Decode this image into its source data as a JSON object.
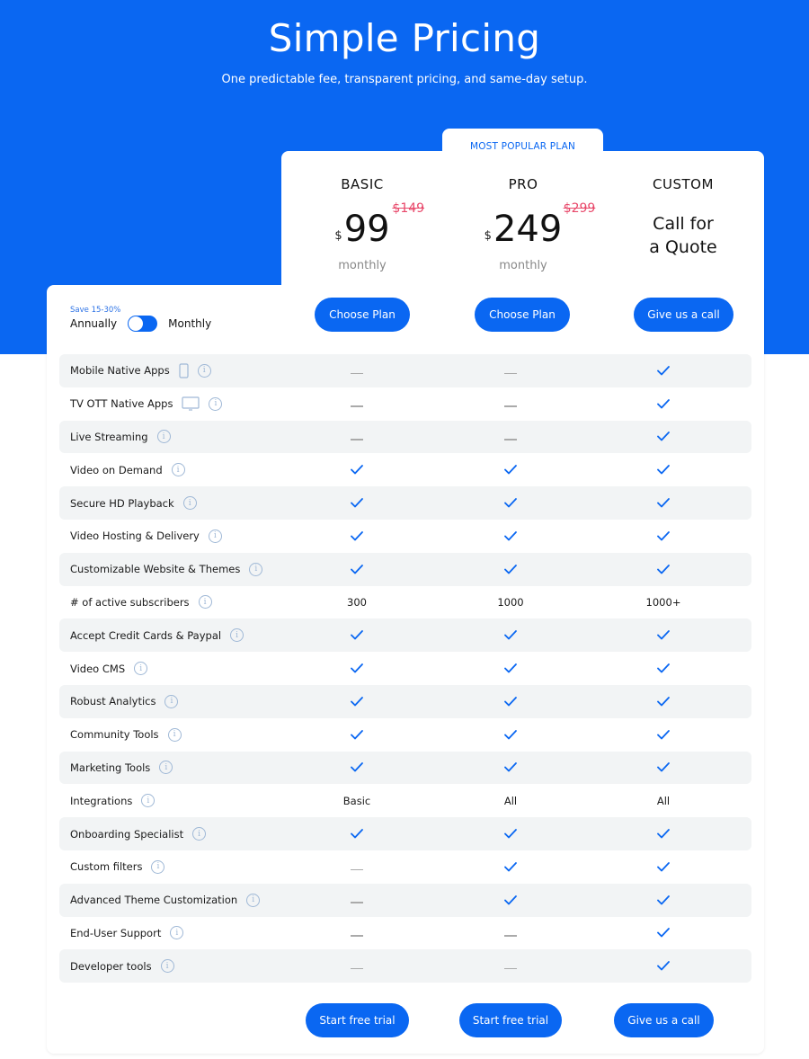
{
  "header": {
    "title": "Simple Pricing",
    "subtitle": "One predictable fee, transparent pricing, and same-day setup."
  },
  "popular_label": "MOST POPULAR PLAN",
  "billing": {
    "save_note": "Save 15-30%",
    "annually_label": "Annually",
    "monthly_label": "Monthly",
    "selected": "Monthly"
  },
  "plans": [
    {
      "name": "BASIC",
      "currency": "$",
      "price": "99",
      "old_price": "$149",
      "period": "monthly",
      "cta": "Choose Plan",
      "bottom_cta": "Start free trial"
    },
    {
      "name": "PRO",
      "currency": "$",
      "price": "249",
      "old_price": "$299",
      "period": "monthly",
      "cta": "Choose Plan",
      "bottom_cta": "Start free trial"
    },
    {
      "name": "CUSTOM",
      "quote": "Call for a Quote",
      "cta": "Give us a call",
      "bottom_cta": "Give us a call"
    }
  ],
  "features": [
    {
      "label": "Mobile Native Apps",
      "icon": "mobile-icon",
      "values": [
        "dash",
        "dash",
        "check"
      ]
    },
    {
      "label": "TV OTT Native Apps",
      "icon": "tv-icon",
      "values": [
        "dash",
        "dash",
        "check"
      ]
    },
    {
      "label": "Live Streaming",
      "values": [
        "dash",
        "dash",
        "check"
      ]
    },
    {
      "label": "Video on Demand",
      "values": [
        "check",
        "check",
        "check"
      ]
    },
    {
      "label": "Secure HD Playback",
      "values": [
        "check",
        "check",
        "check"
      ]
    },
    {
      "label": "Video Hosting & Delivery",
      "values": [
        "check",
        "check",
        "check"
      ]
    },
    {
      "label": "Customizable Website & Themes",
      "values": [
        "check",
        "check",
        "check"
      ]
    },
    {
      "label": "# of active subscribers",
      "values": [
        "300",
        "1000",
        "1000+"
      ]
    },
    {
      "label": "Accept Credit Cards & Paypal",
      "values": [
        "check",
        "check",
        "check"
      ]
    },
    {
      "label": "Video CMS",
      "values": [
        "check",
        "check",
        "check"
      ]
    },
    {
      "label": "Robust Analytics",
      "values": [
        "check",
        "check",
        "check"
      ]
    },
    {
      "label": "Community Tools",
      "values": [
        "check",
        "check",
        "check"
      ]
    },
    {
      "label": "Marketing Tools",
      "values": [
        "check",
        "check",
        "check"
      ]
    },
    {
      "label": "Integrations",
      "values": [
        "Basic",
        "All",
        "All"
      ]
    },
    {
      "label": "Onboarding Specialist",
      "values": [
        "check",
        "check",
        "check"
      ]
    },
    {
      "label": "Custom filters",
      "values": [
        "dash",
        "check",
        "check"
      ]
    },
    {
      "label": "Advanced Theme Customization",
      "values": [
        "dash",
        "check",
        "check"
      ]
    },
    {
      "label": "End-User Support",
      "values": [
        "dash",
        "dash",
        "check"
      ]
    },
    {
      "label": "Developer tools",
      "values": [
        "dash",
        "dash",
        "check"
      ]
    }
  ],
  "colors": {
    "brand": "#0a67f2",
    "strike": "#e8486a",
    "row_shade": "#f2f4f5"
  }
}
